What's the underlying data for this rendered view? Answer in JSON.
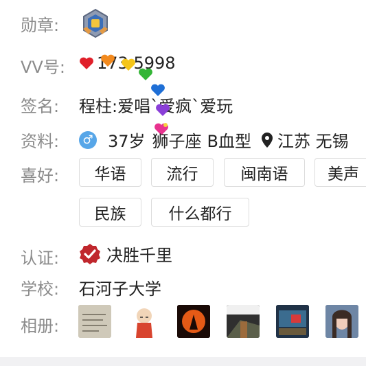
{
  "labels": {
    "medal": "勋章:",
    "vv": "VV号:",
    "signature": "签名:",
    "info": "资料:",
    "hobbies": "喜好:",
    "certification": "认证:",
    "school": "学校:",
    "album": "相册:"
  },
  "vv_number": "173 5998",
  "signature": "程柱:爱唱`爱疯`爱玩",
  "info": {
    "gender_icon": "male-icon",
    "age": "37岁",
    "zodiac": "狮子座",
    "blood_type": "B血型",
    "location_icon": "location-pin-icon",
    "location": "江苏 无锡"
  },
  "hobbies": [
    "华语",
    "流行",
    "闽南语",
    "美声",
    "民族",
    "什么都行"
  ],
  "certification": "决胜千里",
  "school": "石河子大学",
  "album_count_visible": 6,
  "colors": {
    "label": "#8b8b8b",
    "text": "#222222",
    "accent_blue": "#57a6e8",
    "cert_red": "#c0272d",
    "tag_border": "#dcdcdc"
  }
}
